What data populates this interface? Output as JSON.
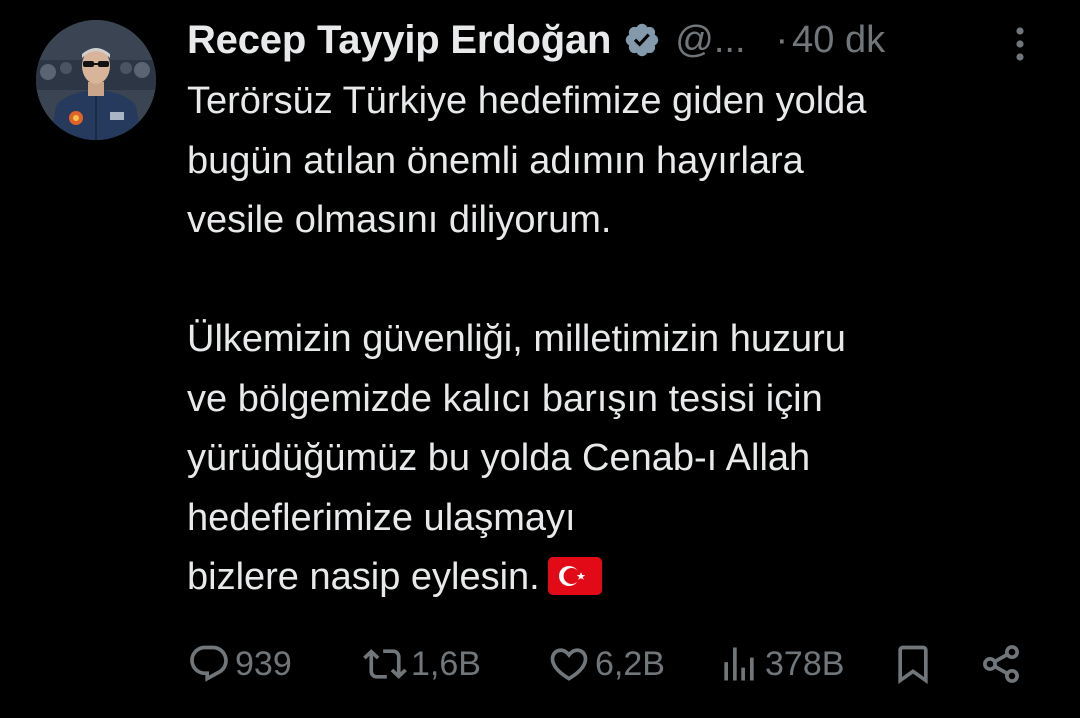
{
  "author": {
    "name": "Recep Tayyip Erdoğan",
    "handle": "@...",
    "separator": "·",
    "time": "40 dk"
  },
  "tweet": {
    "lines": [
      "Terörsüz Türkiye hedefimize giden yolda",
      "bugün atılan önemli adımın hayırlara",
      "vesile olmasını diliyorum.",
      "",
      "Ülkemizin güvenliği, milletimizin huzuru",
      "ve bölgemizde kalıcı barışın tesisi için",
      "yürüdüğümüz bu yolda Cenab-ı Allah",
      "hedeflerimize ulaşmayı",
      "bizlere nasip eylesin."
    ],
    "emoji": "turkey-flag"
  },
  "metrics": {
    "replies": "939",
    "reposts": "1,6B",
    "likes": "6,2B",
    "views": "378B"
  },
  "colors": {
    "background": "#000000",
    "text": "#e7e9ea",
    "muted": "#71767b",
    "verified_badge": "#829aab",
    "flag_red": "#e30a17"
  },
  "icons": {
    "verified": "verified-badge-icon",
    "more": "more-options-icon",
    "reply": "reply-icon",
    "repost": "repost-icon",
    "like": "heart-icon",
    "views": "views-icon",
    "bookmark": "bookmark-icon",
    "share": "share-icon"
  }
}
